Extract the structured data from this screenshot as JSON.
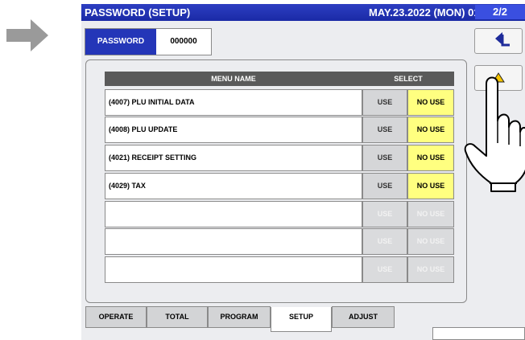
{
  "title": "PASSWORD (SETUP)",
  "datetime": "MAY.23.2022 (MON) 01:42",
  "page_indicator": "2/2",
  "password": {
    "label": "PASSWORD",
    "value": "000000"
  },
  "side_buttons": {
    "back_icon": "return-arrow-icon",
    "up_icon": "triangle-up-icon"
  },
  "table": {
    "headers": {
      "menu_name": "MENU NAME",
      "select": "SELECT"
    },
    "rows": [
      {
        "name": "(4007) PLU INITIAL DATA",
        "use": "USE",
        "no_use": "NO USE"
      },
      {
        "name": "(4008) PLU UPDATE",
        "use": "USE",
        "no_use": "NO USE"
      },
      {
        "name": "(4021) RECEIPT SETTING",
        "use": "USE",
        "no_use": "NO USE"
      },
      {
        "name": "(4029) TAX",
        "use": "USE",
        "no_use": "NO USE"
      },
      {
        "name": "",
        "use": "USE",
        "no_use": "NO USE"
      },
      {
        "name": "",
        "use": "USE",
        "no_use": "NO USE"
      },
      {
        "name": "",
        "use": "USE",
        "no_use": "NO USE"
      }
    ]
  },
  "tabs": [
    {
      "label": "OPERATE"
    },
    {
      "label": "TOTAL"
    },
    {
      "label": "PROGRAM"
    },
    {
      "label": "SETUP"
    },
    {
      "label": "ADJUST"
    }
  ],
  "colors": {
    "title_bar": "#1a2aa6",
    "selected": "#ffff80",
    "header": "#5a5a5a"
  }
}
